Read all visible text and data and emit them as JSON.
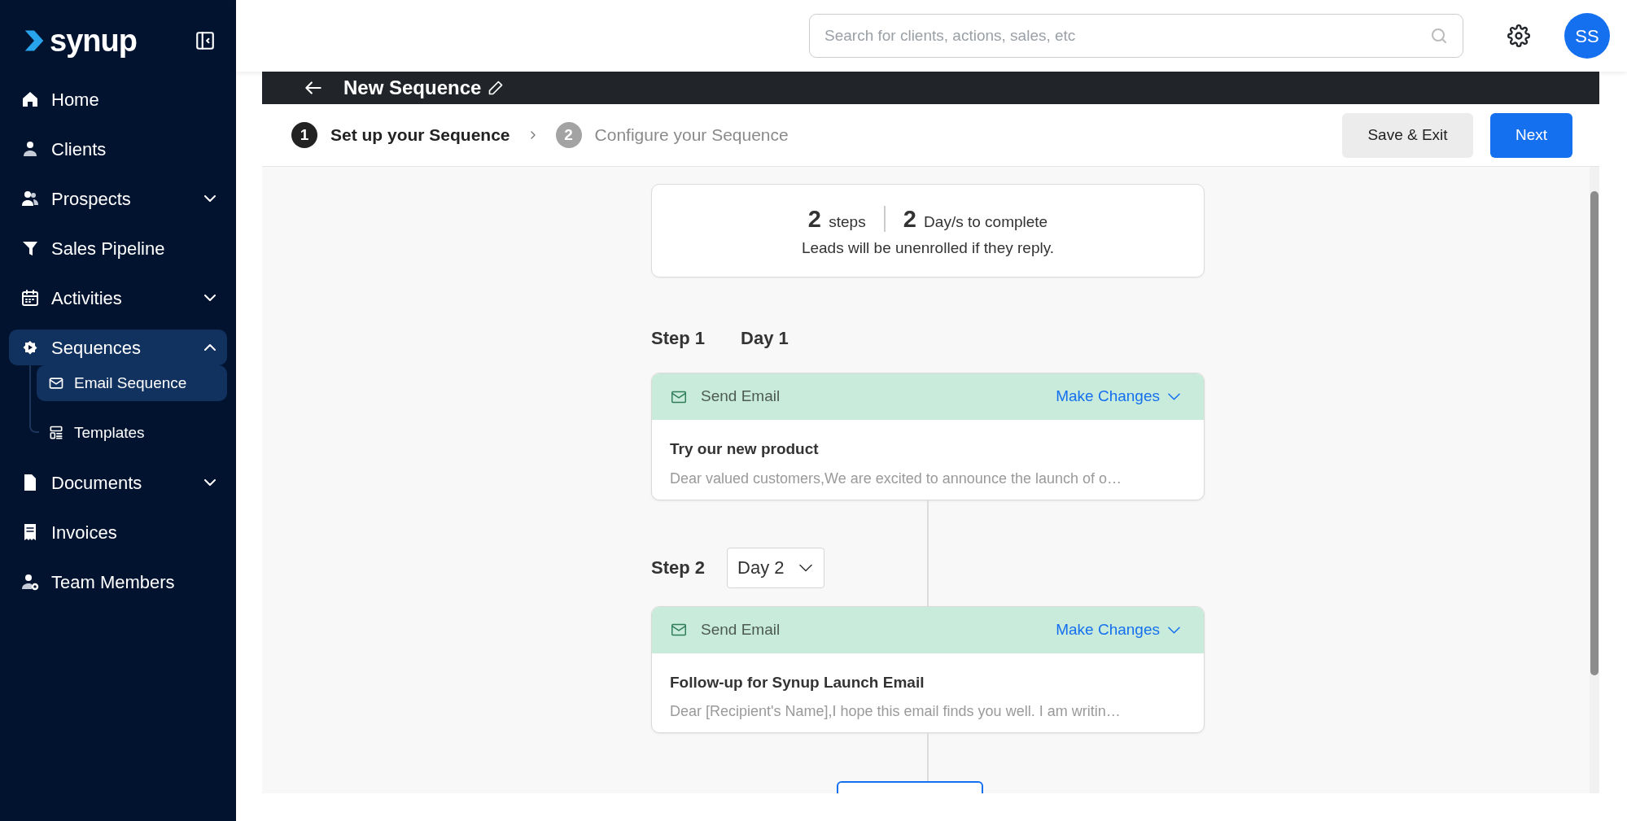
{
  "sidebar": {
    "logo": "synup",
    "items": [
      {
        "label": "Home",
        "selected": false
      },
      {
        "label": "Clients",
        "selected": false
      },
      {
        "label": "Prospects",
        "selected": false,
        "expanded": false
      },
      {
        "label": "Sales Pipeline",
        "selected": false
      },
      {
        "label": "Activities",
        "selected": false,
        "expanded": false
      },
      {
        "label": "Sequences",
        "selected": true,
        "expanded": true,
        "children": [
          {
            "label": "Email Sequence",
            "selected": true
          },
          {
            "label": "Templates",
            "selected": false
          }
        ]
      },
      {
        "label": "Documents",
        "selected": false,
        "expanded": false
      },
      {
        "label": "Invoices",
        "selected": false
      },
      {
        "label": "Team Members",
        "selected": false
      }
    ]
  },
  "header": {
    "search": {
      "placeholder": "Search for clients, actions, sales, etc"
    },
    "avatar": "SS"
  },
  "page_title": "New Sequence",
  "stepper": [
    {
      "number": "1",
      "label": "Set up your Sequence",
      "selected": true
    },
    {
      "number": "2",
      "label": "Configure your Sequence",
      "selected": false
    }
  ],
  "buttons": [
    "Save & Exit",
    "Next"
  ],
  "summary": {
    "steps": "**2** steps",
    "days": "**2** Day/s to complete",
    "note": "Leads will be unenrolled if they reply."
  },
  "steps": [
    {
      "label": "Step 1",
      "day": "Day 1",
      "kind": "text",
      "action": "Send Email",
      "link": "Make Changes",
      "subject": "Try our new product",
      "preview": "Dear valued customers,We are excited to announce the launch of o…"
    },
    {
      "label": "Step 2",
      "day": "Day 2",
      "kind": "dropdown",
      "action": "Send Email",
      "link": "Make Changes",
      "subject": "Follow-up for Synup Launch Email",
      "preview": "Dear [Recipient's Name],I hope this email finds you well. I am writin…"
    }
  ]
}
